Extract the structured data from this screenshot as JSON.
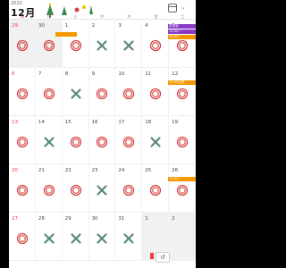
{
  "header": {
    "year": "2020",
    "month": "12月",
    "weekdays": [
      "日",
      "月",
      "火",
      "水",
      "木",
      "金",
      "土"
    ]
  },
  "weeks": [
    {
      "days": [
        {
          "num": "29",
          "dim": true,
          "mark": "circle"
        },
        {
          "num": "30",
          "dim": true,
          "mark": "circle"
        },
        {
          "num": "1",
          "mark": "circle"
        },
        {
          "num": "2",
          "mark": "cross"
        },
        {
          "num": "3",
          "mark": "cross"
        },
        {
          "num": "4",
          "mark": "circle"
        },
        {
          "num": "5",
          "mark": "circle"
        }
      ]
    },
    {
      "days": [
        {
          "num": "6",
          "mark": "circle"
        },
        {
          "num": "7",
          "mark": "circle"
        },
        {
          "num": "8",
          "mark": "cross"
        },
        {
          "num": "9",
          "mark": "circle"
        },
        {
          "num": "10",
          "mark": "circle"
        },
        {
          "num": "11",
          "mark": "circle"
        },
        {
          "num": "12",
          "mark": "circle"
        }
      ]
    },
    {
      "days": [
        {
          "num": "13",
          "mark": "circle"
        },
        {
          "num": "14",
          "mark": "cross"
        },
        {
          "num": "15",
          "mark": "circle"
        },
        {
          "num": "16",
          "mark": "circle"
        },
        {
          "num": "17",
          "mark": "circle"
        },
        {
          "num": "18",
          "mark": "cross"
        },
        {
          "num": "19",
          "mark": "circle"
        }
      ]
    },
    {
      "days": [
        {
          "num": "20",
          "mark": "circle"
        },
        {
          "num": "21",
          "mark": "circle"
        },
        {
          "num": "22",
          "mark": "circle"
        },
        {
          "num": "23",
          "mark": "cross"
        },
        {
          "num": "24",
          "mark": "circle"
        },
        {
          "num": "25",
          "mark": "circle"
        },
        {
          "num": "26",
          "mark": "circle"
        }
      ]
    },
    {
      "days": [
        {
          "num": "27",
          "mark": "circle"
        },
        {
          "num": "28",
          "mark": "cross"
        },
        {
          "num": "29",
          "mark": "cross"
        },
        {
          "num": "30",
          "mark": "cross"
        },
        {
          "num": "31",
          "mark": "cross"
        },
        {
          "num": "1",
          "dim": true,
          "mark": ""
        },
        {
          "num": "2",
          "dim": true,
          "mark": ""
        }
      ]
    }
  ],
  "events": {
    "dec1": "",
    "dec5_a": "年賀状",
    "dec5_b": "13:30~",
    "dec5_c": "15:00~",
    "dec12": "14:00出荷",
    "dec26": "14:00~"
  },
  "colors": {
    "circle": "#d64545",
    "cross": "#5a8a7a",
    "orange": "#f39800",
    "purple": "#8a3cc8",
    "sunday": "#e3413c"
  }
}
